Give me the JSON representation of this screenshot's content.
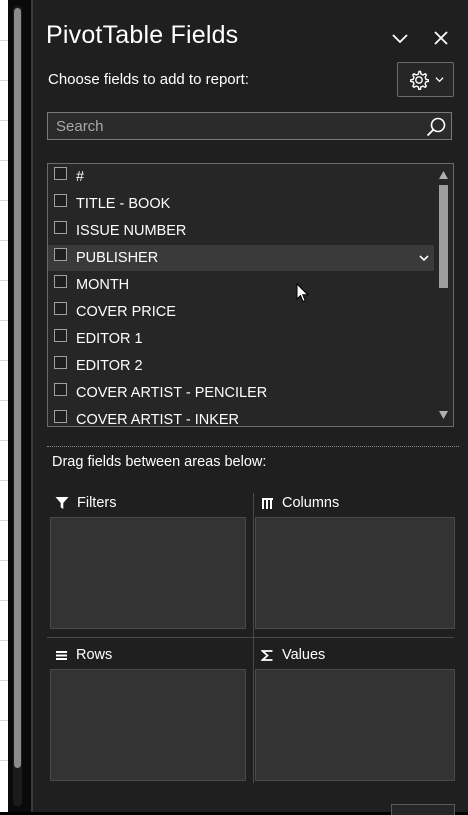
{
  "pane": {
    "title": "PivotTable Fields",
    "subtitle": "Choose fields to add to report:",
    "search_placeholder": "Search"
  },
  "fields": [
    {
      "label": "#",
      "checked": false
    },
    {
      "label": "TITLE - BOOK",
      "checked": false
    },
    {
      "label": "ISSUE NUMBER",
      "checked": false
    },
    {
      "label": "PUBLISHER",
      "checked": false
    },
    {
      "label": "MONTH",
      "checked": false
    },
    {
      "label": "COVER PRICE",
      "checked": false
    },
    {
      "label": "EDITOR 1",
      "checked": false
    },
    {
      "label": "EDITOR 2",
      "checked": false
    },
    {
      "label": "COVER ARTIST - PENCILER",
      "checked": false
    },
    {
      "label": "COVER ARTIST - INKER",
      "checked": false
    }
  ],
  "areas": {
    "instruction": "Drag fields between areas below:",
    "filters": "Filters",
    "columns": "Columns",
    "rows": "Rows",
    "values": "Values"
  },
  "icons": {
    "collapse": "chevron-down-icon",
    "close": "close-icon",
    "settings": "gear-icon",
    "search": "search-icon",
    "filter": "filter-funnel-icon",
    "columns": "columns-icon",
    "rows": "rows-icon",
    "values": "sigma-icon"
  },
  "colors": {
    "panel_bg": "#1f1f1f",
    "area_bg": "#333333",
    "hover_bg": "#3a3a3a"
  }
}
